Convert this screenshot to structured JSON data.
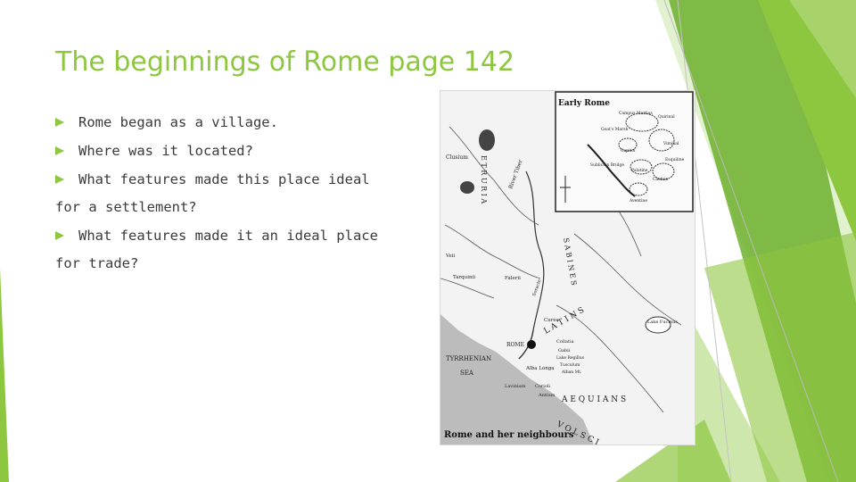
{
  "slide": {
    "title": "The beginnings of Rome page 142",
    "bullets": [
      {
        "text": "Rome began as a village."
      },
      {
        "text": "Where was it located?"
      },
      {
        "text": "What features made this place ideal",
        "continuation": "for a settlement?"
      },
      {
        "text": "What features made it an ideal place",
        "continuation": "for trade?"
      }
    ]
  },
  "map": {
    "inset_title": "Early Rome",
    "inset_labels": [
      "Campus Martius",
      "Goat's Marsh",
      "Capitol",
      "Sublician Bridge",
      "Quirinal",
      "Viminal",
      "Esquiline",
      "Palatine",
      "Caelian",
      "Aventine"
    ],
    "labels": {
      "clusium": "Clusium",
      "etruria": "E T R U R I A",
      "tiber": "River Tiber",
      "tarquinii": "Tarquinii",
      "veii": "Veii",
      "falerii": "Falerii",
      "sabines": "S A B I N E S",
      "cures": "Cures",
      "soracte": "Soracte",
      "rome": "ROME",
      "collatia": "Collatia",
      "gabii": "Gabii",
      "lake_regillus": "Lake Regillus",
      "tusculum": "Tusculum",
      "alban_mt": "Alban Mt.",
      "alba_longa": "Alba Longa",
      "lavinium": "Lavinium",
      "corioli": "Corioli",
      "antium": "Antium",
      "latins": "L A T I N S",
      "lake_fucinus": "Lake Fucinus",
      "aequians": "A E Q U I A N S",
      "volsci": "V O L S C I",
      "tyrrhenian": "TYRRHENIAN",
      "sea": "SEA",
      "caption": "Rome and her neighbours"
    }
  },
  "colors": {
    "accent": "#8dc63f",
    "accent_dark": "#5a9a2a",
    "text": "#3a3a3a"
  }
}
